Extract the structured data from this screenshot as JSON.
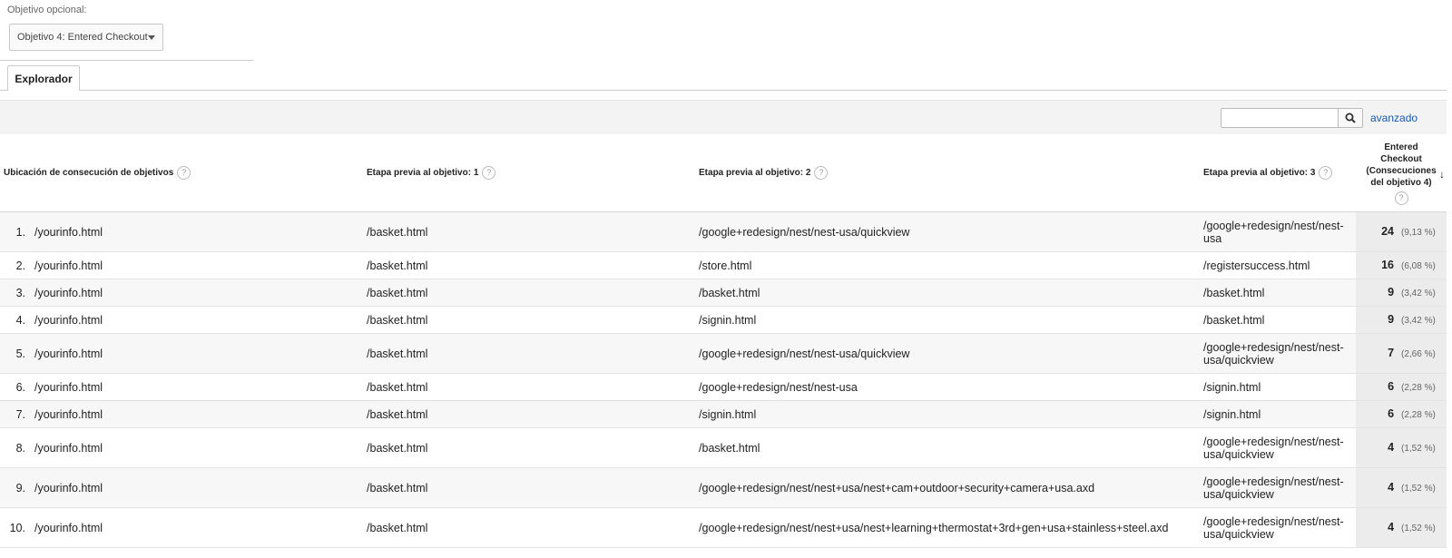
{
  "optional_goal": {
    "label": "Objetivo opcional:",
    "selected": "Objetivo 4: Entered Checkout"
  },
  "tabs": [
    {
      "label": "Explorador"
    }
  ],
  "toolbar": {
    "search_value": "",
    "advanced_label": "avanzado"
  },
  "table": {
    "columns": {
      "location": "Ubicación de consecución de objetivos",
      "step1": "Etapa previa al objetivo: 1",
      "step2": "Etapa previa al objetivo: 2",
      "step3": "Etapa previa al objetivo: 3",
      "metric": "Entered Checkout (Consecuciones del objetivo 4)"
    },
    "help_glyph": "?",
    "sort_glyph": "↓",
    "rows": [
      {
        "index": "1.",
        "location": "/yourinfo.html",
        "step1": "/basket.html",
        "step2": "/google+redesign/nest/nest-usa/quickview",
        "step3": "/google+redesign/nest/nest-usa",
        "value": "24",
        "pct": "(9,13 %)"
      },
      {
        "index": "2.",
        "location": "/yourinfo.html",
        "step1": "/basket.html",
        "step2": "/store.html",
        "step3": "/registersuccess.html",
        "value": "16",
        "pct": "(6,08 %)"
      },
      {
        "index": "3.",
        "location": "/yourinfo.html",
        "step1": "/basket.html",
        "step2": "/basket.html",
        "step3": "/basket.html",
        "value": "9",
        "pct": "(3,42 %)"
      },
      {
        "index": "4.",
        "location": "/yourinfo.html",
        "step1": "/basket.html",
        "step2": "/signin.html",
        "step3": "/basket.html",
        "value": "9",
        "pct": "(3,42 %)"
      },
      {
        "index": "5.",
        "location": "/yourinfo.html",
        "step1": "/basket.html",
        "step2": "/google+redesign/nest/nest-usa/quickview",
        "step3": "/google+redesign/nest/nest-usa/quickview",
        "value": "7",
        "pct": "(2,66 %)"
      },
      {
        "index": "6.",
        "location": "/yourinfo.html",
        "step1": "/basket.html",
        "step2": "/google+redesign/nest/nest-usa",
        "step3": "/signin.html",
        "value": "6",
        "pct": "(2,28 %)"
      },
      {
        "index": "7.",
        "location": "/yourinfo.html",
        "step1": "/basket.html",
        "step2": "/signin.html",
        "step3": "/signin.html",
        "value": "6",
        "pct": "(2,28 %)"
      },
      {
        "index": "8.",
        "location": "/yourinfo.html",
        "step1": "/basket.html",
        "step2": "/basket.html",
        "step3": "/google+redesign/nest/nest-usa/quickview",
        "value": "4",
        "pct": "(1,52 %)"
      },
      {
        "index": "9.",
        "location": "/yourinfo.html",
        "step1": "/basket.html",
        "step2": "/google+redesign/nest/nest+usa/nest+cam+outdoor+security+camera+usa.axd",
        "step3": "/google+redesign/nest/nest-usa/quickview",
        "value": "4",
        "pct": "(1,52 %)"
      },
      {
        "index": "10.",
        "location": "/yourinfo.html",
        "step1": "/basket.html",
        "step2": "/google+redesign/nest/nest+usa/nest+learning+thermostat+3rd+gen+usa+stainless+steel.axd",
        "step3": "/google+redesign/nest/nest-usa/quickview",
        "value": "4",
        "pct": "(1,52 %)"
      }
    ]
  }
}
